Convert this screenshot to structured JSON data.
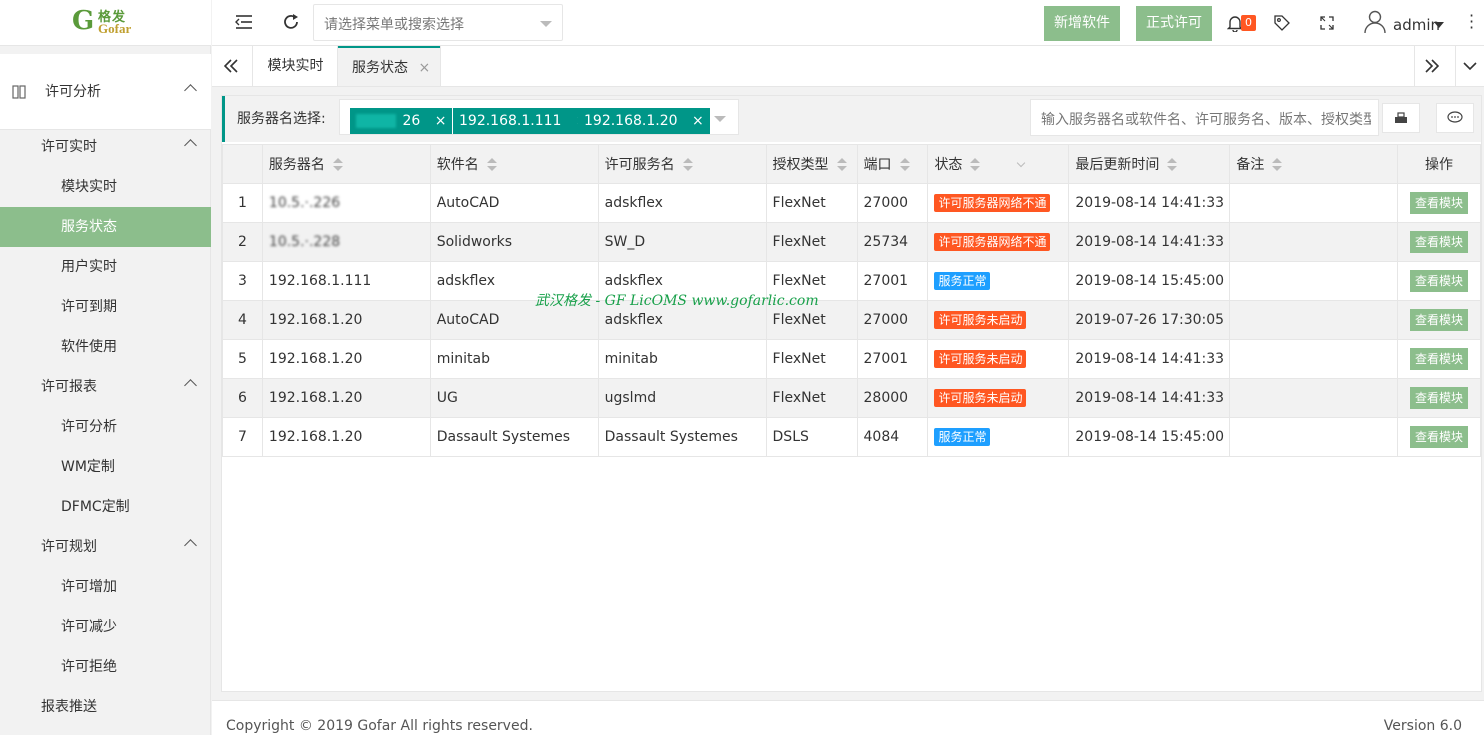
{
  "brand": {
    "glyph": "G",
    "cn": "格发",
    "en": "Gofar"
  },
  "sidebar": {
    "top_item": "许可分析",
    "items": [
      {
        "label": "许可实时",
        "level": 1
      },
      {
        "label": "模块实时",
        "level": 2
      },
      {
        "label": "服务状态",
        "level": 2,
        "active": true
      },
      {
        "label": "用户实时",
        "level": 2
      },
      {
        "label": "许可到期",
        "level": 2
      },
      {
        "label": "软件使用",
        "level": 2
      },
      {
        "label": "许可报表",
        "level": 1
      },
      {
        "label": "许可分析",
        "level": 2
      },
      {
        "label": "WM定制",
        "level": 2
      },
      {
        "label": "DFMC定制",
        "level": 2
      },
      {
        "label": "许可规划",
        "level": 1
      },
      {
        "label": "许可增加",
        "level": 2
      },
      {
        "label": "许可减少",
        "level": 2
      },
      {
        "label": "许可拒绝",
        "level": 2
      },
      {
        "label": "报表推送",
        "level": 1
      }
    ]
  },
  "header": {
    "menu_search_placeholder": "请选择菜单或搜索选择",
    "add_software": "新增软件",
    "formal_license": "正式许可",
    "notification_count": "0",
    "user": "admin"
  },
  "tabs": [
    {
      "label": "模块实时"
    },
    {
      "label": "服务状态",
      "active": true,
      "close": "×"
    }
  ],
  "filter": {
    "label": "服务器名选择:",
    "chips": [
      "26",
      "192.168.1.111",
      "192.168.1.20"
    ],
    "chip_close": "×",
    "search_placeholder": "输入服务器名或软件名、许可服务名、版本、授权类型"
  },
  "table": {
    "columns": [
      "服务器名",
      "软件名",
      "许可服务名",
      "授权类型",
      "端口",
      "状态",
      "最后更新时间",
      "备注",
      "操作"
    ],
    "rows": [
      {
        "no": "1",
        "server": "10.5.·.226",
        "software": "AutoCAD",
        "service": "adskflex",
        "type": "FlexNet",
        "port": "27000",
        "status": "许可服务器网络不通",
        "status_color": "#ff5722",
        "updated": "2019-08-14 14:41:33",
        "remark": "",
        "action": "查看模块"
      },
      {
        "no": "2",
        "server": "10.5.·.228",
        "software": "Solidworks",
        "service": "SW_D",
        "type": "FlexNet",
        "port": "25734",
        "status": "许可服务器网络不通",
        "status_color": "#ff5722",
        "updated": "2019-08-14 14:41:33",
        "remark": "",
        "action": "查看模块"
      },
      {
        "no": "3",
        "server": "192.168.1.111",
        "software": "adskflex",
        "service": "adskflex",
        "type": "FlexNet",
        "port": "27001",
        "status": "服务正常",
        "status_color": "#1e9fff",
        "updated": "2019-08-14 15:45:00",
        "remark": "",
        "action": "查看模块"
      },
      {
        "no": "4",
        "server": "192.168.1.20",
        "software": "AutoCAD",
        "service": "adskflex",
        "type": "FlexNet",
        "port": "27000",
        "status": "许可服务未启动",
        "status_color": "#ff5722",
        "updated": "2019-07-26 17:30:05",
        "remark": "",
        "action": "查看模块"
      },
      {
        "no": "5",
        "server": "192.168.1.20",
        "software": "minitab",
        "service": "minitab",
        "type": "FlexNet",
        "port": "27001",
        "status": "许可服务未启动",
        "status_color": "#ff5722",
        "updated": "2019-08-14 14:41:33",
        "remark": "",
        "action": "查看模块"
      },
      {
        "no": "6",
        "server": "192.168.1.20",
        "software": "UG",
        "service": "ugslmd",
        "type": "FlexNet",
        "port": "28000",
        "status": "许可服务未启动",
        "status_color": "#ff5722",
        "updated": "2019-08-14 14:41:33",
        "remark": "",
        "action": "查看模块"
      },
      {
        "no": "7",
        "server": "192.168.1.20",
        "software": "Dassault Systemes",
        "service": "Dassault Systemes",
        "type": "DSLS",
        "port": "4084",
        "status": "服务正常",
        "status_color": "#1e9fff",
        "updated": "2019-08-14 15:45:00",
        "remark": "",
        "action": "查看模块"
      }
    ]
  },
  "watermark": "武汉格发 - GF LicOMS  www.gofarlic.com",
  "footer": {
    "copyright": "Copyright © 2019 Gofar All rights reserved.",
    "version": "Version 6.0"
  }
}
